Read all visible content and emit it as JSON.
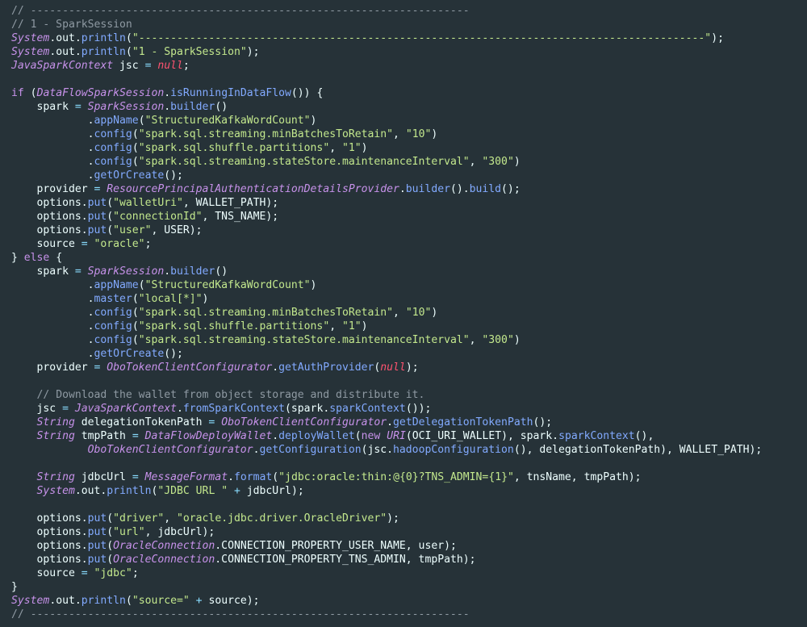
{
  "editor": {
    "language": "java",
    "colors": {
      "background": "#263238",
      "comment": "#8f9aa3",
      "type": "#c792ea",
      "keyword": "#c792ea",
      "method": "#82aaff",
      "string": "#c3e88d",
      "operator": "#89ddff",
      "null": "#ff5370",
      "plain": "#eeffff"
    },
    "lines": [
      [
        [
          "c",
          "// ---------------------------------------------------------------------"
        ]
      ],
      [
        [
          "c",
          "// 1 - SparkSession"
        ]
      ],
      [
        [
          "t",
          "System"
        ],
        [
          "v",
          "."
        ],
        [
          "v",
          "out"
        ],
        [
          "v",
          "."
        ],
        [
          "m",
          "println"
        ],
        [
          "v",
          "("
        ],
        [
          "s",
          "\"-----------------------------------------------------------------------------------------\""
        ],
        [
          "v",
          ");"
        ]
      ],
      [
        [
          "t",
          "System"
        ],
        [
          "v",
          "."
        ],
        [
          "v",
          "out"
        ],
        [
          "v",
          "."
        ],
        [
          "m",
          "println"
        ],
        [
          "v",
          "("
        ],
        [
          "s",
          "\"1 - SparkSession\""
        ],
        [
          "v",
          ");"
        ]
      ],
      [
        [
          "t",
          "JavaSparkContext"
        ],
        [
          "v",
          " jsc "
        ],
        [
          "o",
          "="
        ],
        [
          "v",
          " "
        ],
        [
          "kn",
          "null"
        ],
        [
          "v",
          ";"
        ]
      ],
      [],
      [
        [
          "k",
          "if"
        ],
        [
          "v",
          " ("
        ],
        [
          "t",
          "DataFlowSparkSession"
        ],
        [
          "v",
          "."
        ],
        [
          "m",
          "isRunningInDataFlow"
        ],
        [
          "v",
          "()) {"
        ]
      ],
      [
        [
          "v",
          "    spark "
        ],
        [
          "o",
          "="
        ],
        [
          "v",
          " "
        ],
        [
          "t",
          "SparkSession"
        ],
        [
          "v",
          "."
        ],
        [
          "m",
          "builder"
        ],
        [
          "v",
          "()"
        ]
      ],
      [
        [
          "v",
          "            "
        ],
        [
          "v",
          "."
        ],
        [
          "m",
          "appName"
        ],
        [
          "v",
          "("
        ],
        [
          "s",
          "\"StructuredKafkaWordCount\""
        ],
        [
          "v",
          ")"
        ]
      ],
      [
        [
          "v",
          "            "
        ],
        [
          "v",
          "."
        ],
        [
          "m",
          "config"
        ],
        [
          "v",
          "("
        ],
        [
          "s",
          "\"spark.sql.streaming.minBatchesToRetain\""
        ],
        [
          "v",
          ", "
        ],
        [
          "s",
          "\"10\""
        ],
        [
          "v",
          ")"
        ]
      ],
      [
        [
          "v",
          "            "
        ],
        [
          "v",
          "."
        ],
        [
          "m",
          "config"
        ],
        [
          "v",
          "("
        ],
        [
          "s",
          "\"spark.sql.shuffle.partitions\""
        ],
        [
          "v",
          ", "
        ],
        [
          "s",
          "\"1\""
        ],
        [
          "v",
          ")"
        ]
      ],
      [
        [
          "v",
          "            "
        ],
        [
          "v",
          "."
        ],
        [
          "m",
          "config"
        ],
        [
          "v",
          "("
        ],
        [
          "s",
          "\"spark.sql.streaming.stateStore.maintenanceInterval\""
        ],
        [
          "v",
          ", "
        ],
        [
          "s",
          "\"300\""
        ],
        [
          "v",
          ")"
        ]
      ],
      [
        [
          "v",
          "            "
        ],
        [
          "v",
          "."
        ],
        [
          "m",
          "getOrCreate"
        ],
        [
          "v",
          "();"
        ]
      ],
      [
        [
          "v",
          "    provider "
        ],
        [
          "o",
          "="
        ],
        [
          "v",
          " "
        ],
        [
          "t",
          "ResourcePrincipalAuthenticationDetailsProvider"
        ],
        [
          "v",
          "."
        ],
        [
          "m",
          "builder"
        ],
        [
          "v",
          "()."
        ],
        [
          "m",
          "build"
        ],
        [
          "v",
          "();"
        ]
      ],
      [
        [
          "v",
          "    options."
        ],
        [
          "m",
          "put"
        ],
        [
          "v",
          "("
        ],
        [
          "s",
          "\"walletUri\""
        ],
        [
          "v",
          ", WALLET_PATH);"
        ]
      ],
      [
        [
          "v",
          "    options."
        ],
        [
          "m",
          "put"
        ],
        [
          "v",
          "("
        ],
        [
          "s",
          "\"connectionId\""
        ],
        [
          "v",
          ", TNS_NAME);"
        ]
      ],
      [
        [
          "v",
          "    options."
        ],
        [
          "m",
          "put"
        ],
        [
          "v",
          "("
        ],
        [
          "s",
          "\"user\""
        ],
        [
          "v",
          ", USER);"
        ]
      ],
      [
        [
          "v",
          "    source "
        ],
        [
          "o",
          "="
        ],
        [
          "v",
          " "
        ],
        [
          "s",
          "\"oracle\""
        ],
        [
          "v",
          ";"
        ]
      ],
      [
        [
          "v",
          "} "
        ],
        [
          "k",
          "else"
        ],
        [
          "v",
          " {"
        ]
      ],
      [
        [
          "v",
          "    spark "
        ],
        [
          "o",
          "="
        ],
        [
          "v",
          " "
        ],
        [
          "t",
          "SparkSession"
        ],
        [
          "v",
          "."
        ],
        [
          "m",
          "builder"
        ],
        [
          "v",
          "()"
        ]
      ],
      [
        [
          "v",
          "            "
        ],
        [
          "v",
          "."
        ],
        [
          "m",
          "appName"
        ],
        [
          "v",
          "("
        ],
        [
          "s",
          "\"StructuredKafkaWordCount\""
        ],
        [
          "v",
          ")"
        ]
      ],
      [
        [
          "v",
          "            "
        ],
        [
          "v",
          "."
        ],
        [
          "m",
          "master"
        ],
        [
          "v",
          "("
        ],
        [
          "s",
          "\"local[*]\""
        ],
        [
          "v",
          ")"
        ]
      ],
      [
        [
          "v",
          "            "
        ],
        [
          "v",
          "."
        ],
        [
          "m",
          "config"
        ],
        [
          "v",
          "("
        ],
        [
          "s",
          "\"spark.sql.streaming.minBatchesToRetain\""
        ],
        [
          "v",
          ", "
        ],
        [
          "s",
          "\"10\""
        ],
        [
          "v",
          ")"
        ]
      ],
      [
        [
          "v",
          "            "
        ],
        [
          "v",
          "."
        ],
        [
          "m",
          "config"
        ],
        [
          "v",
          "("
        ],
        [
          "s",
          "\"spark.sql.shuffle.partitions\""
        ],
        [
          "v",
          ", "
        ],
        [
          "s",
          "\"1\""
        ],
        [
          "v",
          ")"
        ]
      ],
      [
        [
          "v",
          "            "
        ],
        [
          "v",
          "."
        ],
        [
          "m",
          "config"
        ],
        [
          "v",
          "("
        ],
        [
          "s",
          "\"spark.sql.streaming.stateStore.maintenanceInterval\""
        ],
        [
          "v",
          ", "
        ],
        [
          "s",
          "\"300\""
        ],
        [
          "v",
          ")"
        ]
      ],
      [
        [
          "v",
          "            "
        ],
        [
          "v",
          "."
        ],
        [
          "m",
          "getOrCreate"
        ],
        [
          "v",
          "();"
        ]
      ],
      [
        [
          "v",
          "    provider "
        ],
        [
          "o",
          "="
        ],
        [
          "v",
          " "
        ],
        [
          "t",
          "OboTokenClientConfigurator"
        ],
        [
          "v",
          "."
        ],
        [
          "m",
          "getAuthProvider"
        ],
        [
          "v",
          "("
        ],
        [
          "kn",
          "null"
        ],
        [
          "v",
          ");"
        ]
      ],
      [],
      [
        [
          "v",
          "    "
        ],
        [
          "c",
          "// Download the wallet from object storage and distribute it."
        ]
      ],
      [
        [
          "v",
          "    jsc "
        ],
        [
          "o",
          "="
        ],
        [
          "v",
          " "
        ],
        [
          "t",
          "JavaSparkContext"
        ],
        [
          "v",
          "."
        ],
        [
          "m",
          "fromSparkContext"
        ],
        [
          "v",
          "(spark."
        ],
        [
          "m",
          "sparkContext"
        ],
        [
          "v",
          "());"
        ]
      ],
      [
        [
          "v",
          "    "
        ],
        [
          "t",
          "String"
        ],
        [
          "v",
          " delegationTokenPath "
        ],
        [
          "o",
          "="
        ],
        [
          "v",
          " "
        ],
        [
          "t",
          "OboTokenClientConfigurator"
        ],
        [
          "v",
          "."
        ],
        [
          "m",
          "getDelegationTokenPath"
        ],
        [
          "v",
          "();"
        ]
      ],
      [
        [
          "v",
          "    "
        ],
        [
          "t",
          "String"
        ],
        [
          "v",
          " tmpPath "
        ],
        [
          "o",
          "="
        ],
        [
          "v",
          " "
        ],
        [
          "t",
          "DataFlowDeployWallet"
        ],
        [
          "v",
          "."
        ],
        [
          "m",
          "deployWallet"
        ],
        [
          "v",
          "("
        ],
        [
          "k",
          "new"
        ],
        [
          "v",
          " "
        ],
        [
          "t",
          "URI"
        ],
        [
          "v",
          "(OCI_URI_WALLET), spark."
        ],
        [
          "m",
          "sparkContext"
        ],
        [
          "v",
          "(),"
        ]
      ],
      [
        [
          "v",
          "            "
        ],
        [
          "t",
          "OboTokenClientConfigurator"
        ],
        [
          "v",
          "."
        ],
        [
          "m",
          "getConfiguration"
        ],
        [
          "v",
          "(jsc."
        ],
        [
          "m",
          "hadoopConfiguration"
        ],
        [
          "v",
          "(), delegationTokenPath), WALLET_PATH);"
        ]
      ],
      [],
      [
        [
          "v",
          "    "
        ],
        [
          "t",
          "String"
        ],
        [
          "v",
          " jdbcUrl "
        ],
        [
          "o",
          "="
        ],
        [
          "v",
          " "
        ],
        [
          "t",
          "MessageFormat"
        ],
        [
          "v",
          "."
        ],
        [
          "m",
          "format"
        ],
        [
          "v",
          "("
        ],
        [
          "s",
          "\"jdbc:oracle:thin:@{0}?TNS_ADMIN={1}\""
        ],
        [
          "v",
          ", tnsName, tmpPath);"
        ]
      ],
      [
        [
          "v",
          "    "
        ],
        [
          "t",
          "System"
        ],
        [
          "v",
          "."
        ],
        [
          "v",
          "out"
        ],
        [
          "v",
          "."
        ],
        [
          "m",
          "println"
        ],
        [
          "v",
          "("
        ],
        [
          "s",
          "\"JDBC URL \""
        ],
        [
          "v",
          " "
        ],
        [
          "o",
          "+"
        ],
        [
          "v",
          " jdbcUrl);"
        ]
      ],
      [],
      [
        [
          "v",
          "    options."
        ],
        [
          "m",
          "put"
        ],
        [
          "v",
          "("
        ],
        [
          "s",
          "\"driver\""
        ],
        [
          "v",
          ", "
        ],
        [
          "s",
          "\"oracle.jdbc.driver.OracleDriver\""
        ],
        [
          "v",
          ");"
        ]
      ],
      [
        [
          "v",
          "    options."
        ],
        [
          "m",
          "put"
        ],
        [
          "v",
          "("
        ],
        [
          "s",
          "\"url\""
        ],
        [
          "v",
          ", jdbcUrl);"
        ]
      ],
      [
        [
          "v",
          "    options."
        ],
        [
          "m",
          "put"
        ],
        [
          "v",
          "("
        ],
        [
          "t",
          "OracleConnection"
        ],
        [
          "v",
          ".CONNECTION_PROPERTY_USER_NAME, user);"
        ]
      ],
      [
        [
          "v",
          "    options."
        ],
        [
          "m",
          "put"
        ],
        [
          "v",
          "("
        ],
        [
          "t",
          "OracleConnection"
        ],
        [
          "v",
          ".CONNECTION_PROPERTY_TNS_ADMIN, tmpPath);"
        ]
      ],
      [
        [
          "v",
          "    source "
        ],
        [
          "o",
          "="
        ],
        [
          "v",
          " "
        ],
        [
          "s",
          "\"jdbc\""
        ],
        [
          "v",
          ";"
        ]
      ],
      [
        [
          "v",
          "}"
        ]
      ],
      [
        [
          "t",
          "System"
        ],
        [
          "v",
          "."
        ],
        [
          "v",
          "out"
        ],
        [
          "v",
          "."
        ],
        [
          "m",
          "println"
        ],
        [
          "v",
          "("
        ],
        [
          "s",
          "\"source=\""
        ],
        [
          "v",
          " "
        ],
        [
          "o",
          "+"
        ],
        [
          "v",
          " source);"
        ]
      ],
      [
        [
          "c",
          "// ---------------------------------------------------------------------"
        ]
      ]
    ]
  }
}
